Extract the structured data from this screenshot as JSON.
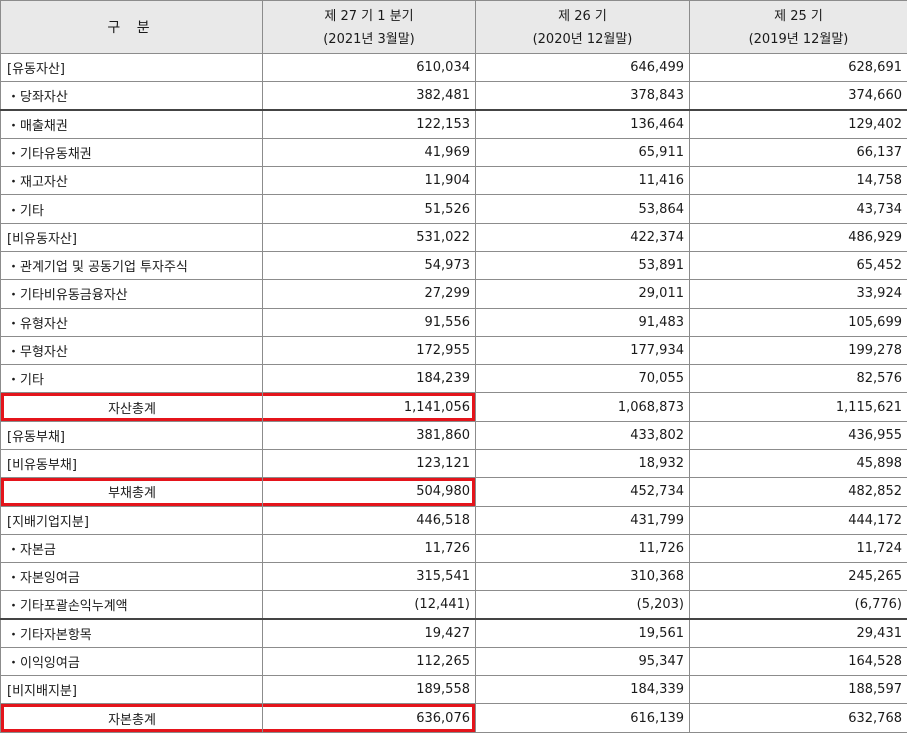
{
  "header": {
    "label": "구 분",
    "columns": [
      {
        "title": "제 27 기 1 분기",
        "sub": "(2021년 3월말)"
      },
      {
        "title": "제 26 기",
        "sub": "(2020년 12월말)"
      },
      {
        "title": "제 25 기",
        "sub": "(2019년 12월말)"
      }
    ]
  },
  "rows": [
    {
      "label": "[유동자산]",
      "values": [
        "610,034",
        "646,499",
        "628,691"
      ]
    },
    {
      "label": "・당좌자산",
      "values": [
        "382,481",
        "378,843",
        "374,660"
      ]
    },
    {
      "label": "・매출채권",
      "values": [
        "122,153",
        "136,464",
        "129,402"
      ]
    },
    {
      "label": "・기타유동채권",
      "values": [
        "41,969",
        "65,911",
        "66,137"
      ]
    },
    {
      "label": "・재고자산",
      "values": [
        "11,904",
        "11,416",
        "14,758"
      ]
    },
    {
      "label": "・기타",
      "values": [
        "51,526",
        "53,864",
        "43,734"
      ]
    },
    {
      "label": "[비유동자산]",
      "values": [
        "531,022",
        "422,374",
        "486,929"
      ]
    },
    {
      "label": "・관계기업 및 공동기업 투자주식",
      "values": [
        "54,973",
        "53,891",
        "65,452"
      ]
    },
    {
      "label": "・기타비유동금융자산",
      "values": [
        "27,299",
        "29,011",
        "33,924"
      ]
    },
    {
      "label": "・유형자산",
      "values": [
        "91,556",
        "91,483",
        "105,699"
      ]
    },
    {
      "label": "・무형자산",
      "values": [
        "172,955",
        "177,934",
        "199,278"
      ]
    },
    {
      "label": "・기타",
      "values": [
        "184,239",
        "70,055",
        "82,576"
      ]
    },
    {
      "label": "자산총계",
      "values": [
        "1,141,056",
        "1,068,873",
        "1,115,621"
      ]
    },
    {
      "label": "[유동부채]",
      "values": [
        "381,860",
        "433,802",
        "436,955"
      ]
    },
    {
      "label": "[비유동부채]",
      "values": [
        "123,121",
        "18,932",
        "45,898"
      ]
    },
    {
      "label": "부채총계",
      "values": [
        "504,980",
        "452,734",
        "482,852"
      ]
    },
    {
      "label": "[지배기업지분]",
      "values": [
        "446,518",
        "431,799",
        "444,172"
      ]
    },
    {
      "label": "・자본금",
      "values": [
        "11,726",
        "11,726",
        "11,724"
      ]
    },
    {
      "label": "・자본잉여금",
      "values": [
        "315,541",
        "310,368",
        "245,265"
      ]
    },
    {
      "label": "・기타포괄손익누계액",
      "values": [
        "(12,441)",
        "(5,203)",
        "(6,776)"
      ]
    },
    {
      "label": "・기타자본항목",
      "values": [
        "19,427",
        "19,561",
        "29,431"
      ]
    },
    {
      "label": "・이익잉여금",
      "values": [
        "112,265",
        "95,347",
        "164,528"
      ]
    },
    {
      "label": "[비지배지분]",
      "values": [
        "189,558",
        "184,339",
        "188,597"
      ]
    },
    {
      "label": "자본총계",
      "values": [
        "636,076",
        "616,139",
        "632,768"
      ]
    }
  ],
  "highlight_color": "#e4141b"
}
